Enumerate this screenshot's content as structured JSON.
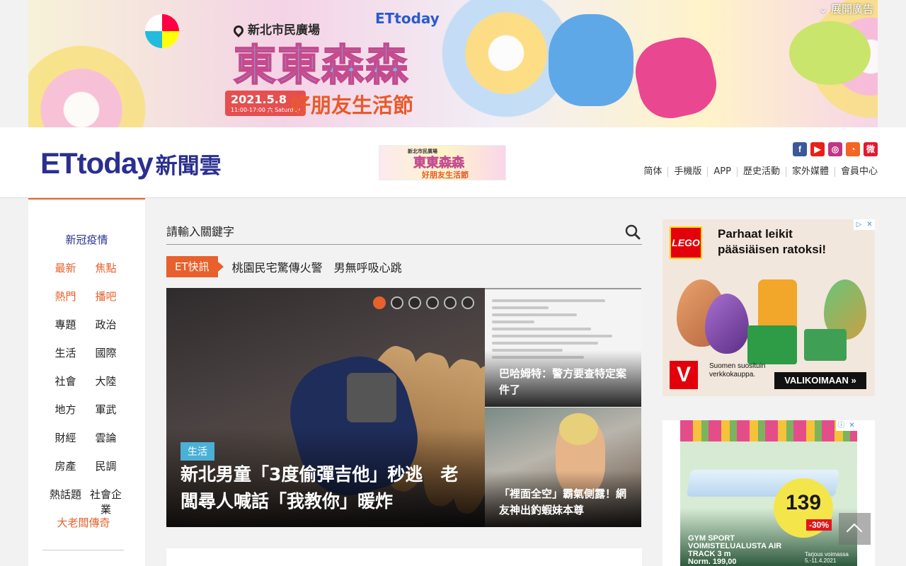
{
  "top_banner": {
    "venue": "新北市民廣場",
    "brand": "ETtoday",
    "title": "東東森森",
    "date": "2021.5.8",
    "time": "11:00-17:00 六 Saturday",
    "subtitle": "好朋友生活節",
    "expand_label": "展開廣告"
  },
  "header": {
    "logo_latin": "ETtoday",
    "logo_cn": "新聞雲",
    "small_ad": {
      "venue": "新北市民廣場",
      "title": "東東森森",
      "subtitle": "好朋友生活節"
    },
    "socials": [
      {
        "name": "facebook-icon",
        "glyph": "f",
        "color": "#3b5998"
      },
      {
        "name": "youtube-icon",
        "glyph": "▶",
        "color": "#e62117"
      },
      {
        "name": "instagram-icon",
        "glyph": "◎",
        "color": "#c13584"
      },
      {
        "name": "rss-icon",
        "glyph": "◔",
        "color": "#f26522"
      },
      {
        "name": "weibo-icon",
        "glyph": "微",
        "color": "#e6162d"
      }
    ],
    "links": [
      "简体",
      "手機版",
      "APP",
      "歷史活動",
      "家外媒體",
      "會員中心"
    ]
  },
  "sidebar": {
    "covid": "新冠疫情",
    "rows": [
      [
        "最新",
        "焦點"
      ],
      [
        "熱門",
        "播吧"
      ],
      [
        "專題",
        "政治"
      ],
      [
        "生活",
        "國際"
      ],
      [
        "社會",
        "大陸"
      ],
      [
        "地方",
        "軍武"
      ],
      [
        "財經",
        "雲論"
      ],
      [
        "房產",
        "民調"
      ],
      [
        "熱話題",
        "社會企業"
      ]
    ],
    "boss": "大老闆傳奇"
  },
  "search": {
    "placeholder": "請輸入關鍵字"
  },
  "quick_news": {
    "tag": "ET快訊",
    "headline": "桃園民宅驚傳火警　男無呼吸心跳"
  },
  "hero": {
    "category": "生活",
    "title": "新北男童「3度偷彈吉他」秒逃　老闆尋人喊話「我教你」暖炸",
    "slides": 6,
    "active_slide": 1
  },
  "side_cards": [
    {
      "title": "巴哈姆特：警方要查特定案件了"
    },
    {
      "title": "「裡面全空」霸氣側露！網友神出釣蝦妹本尊"
    }
  ],
  "ads": {
    "lego": {
      "logo": "LEGO",
      "headline": "Parhaat leikit pääsiäisen ratoksi!",
      "v_logo": "V",
      "small_text": "Suomen suosituin verkkokauppa.",
      "cta": "VALIKOIMAAN »"
    },
    "gym": {
      "price": "139",
      "discount": "-30%",
      "title": "GYM SPORT VOIMISTELUALUSTA AIR TRACK 3 m",
      "norm": "Norm. 199,00",
      "offer": "Tarjous voimassa 5.-11.4.2021"
    }
  }
}
